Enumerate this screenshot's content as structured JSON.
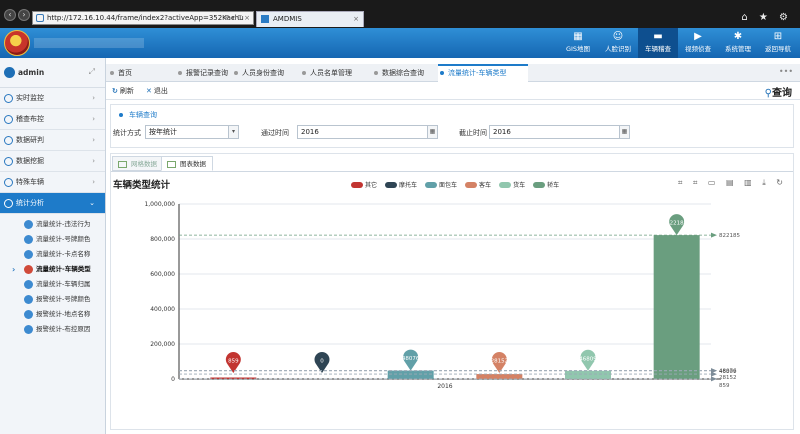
{
  "browser": {
    "url": "http://172.16.10.44/frame/index2?activeApp=352Kachu",
    "url_tools": "P ▾ C ×",
    "tab_title": "AMDMIS",
    "window_icons": "⌂ ★ ⚙"
  },
  "top_nav": [
    {
      "label": "GIS地图",
      "icon": "map-icon",
      "glyph": "▦",
      "active": false
    },
    {
      "label": "人脸识别",
      "icon": "face-scan-icon",
      "glyph": "☺",
      "active": false
    },
    {
      "label": "车辆稽查",
      "icon": "truck-icon",
      "glyph": "▬",
      "active": true
    },
    {
      "label": "视频侦查",
      "icon": "video-icon",
      "glyph": "▶",
      "active": false
    },
    {
      "label": "系统管理",
      "icon": "gear-icon",
      "glyph": "✱",
      "active": false
    },
    {
      "label": "返回导航",
      "icon": "grid-icon",
      "glyph": "⊞",
      "active": false
    }
  ],
  "sidebar": {
    "user": "admin",
    "menu": [
      {
        "label": "实时监控",
        "active": false
      },
      {
        "label": "稽查布控",
        "active": false
      },
      {
        "label": "数据研判",
        "active": false
      },
      {
        "label": "数据挖掘",
        "active": false
      },
      {
        "label": "特殊车辆",
        "active": false
      },
      {
        "label": "统计分析",
        "active": true
      }
    ],
    "sub_items": [
      {
        "label": "流量统计-违法行为",
        "current": false
      },
      {
        "label": "流量统计-号牌颜色",
        "current": false
      },
      {
        "label": "流量统计-卡点名称",
        "current": false
      },
      {
        "label": "流量统计-车辆类型",
        "current": true
      },
      {
        "label": "流量统计-车辆归属",
        "current": false
      },
      {
        "label": "报警统计-号牌颜色",
        "current": false
      },
      {
        "label": "报警统计-地点名称",
        "current": false
      },
      {
        "label": "报警统计-布控原因",
        "current": false
      }
    ]
  },
  "page_tabs": [
    {
      "label": "首页",
      "active": false
    },
    {
      "label": "报警记录查询",
      "active": false
    },
    {
      "label": "人员身份查询",
      "active": false
    },
    {
      "label": "人员名单管理",
      "active": false
    },
    {
      "label": "数据综合查询",
      "active": false
    },
    {
      "label": "流量统计-车辆类型",
      "active": true
    }
  ],
  "toolbar": {
    "refresh": "刷新",
    "exit": "退出",
    "query": "查询"
  },
  "filter": {
    "section_title": "车辆查询",
    "method_label": "统计方式",
    "method_value": "按年统计",
    "start_label": "通过时间",
    "start_value": "2016",
    "end_label": "截止时间",
    "end_value": "2016"
  },
  "chart_tabs": {
    "grid": "网格数据",
    "chart": "图表数据"
  },
  "chart_data": {
    "type": "bar",
    "title": "车辆类型统计",
    "categories": [
      "2016"
    ],
    "series": [
      {
        "name": "其它",
        "values": [
          859
        ],
        "color": "#c23531"
      },
      {
        "name": "摩托车",
        "values": [
          0
        ],
        "color": "#2f4554"
      },
      {
        "name": "面包车",
        "values": [
          48076
        ],
        "color": "#61a0a8"
      },
      {
        "name": "客车",
        "values": [
          28152
        ],
        "color": "#d48265"
      },
      {
        "name": "货车",
        "values": [
          46809
        ],
        "color": "#91c7ae"
      },
      {
        "name": "轿车",
        "values": [
          822185
        ],
        "color": "#6a9e7f"
      }
    ],
    "pin_labels": [
      "859",
      "0",
      "48076",
      "28152",
      "46809",
      "822185"
    ],
    "ylim": [
      0,
      1000000
    ],
    "yticks": [
      0,
      200000,
      400000,
      600000,
      800000,
      1000000
    ],
    "ytick_labels": [
      "0",
      "200,000",
      "400,000",
      "600,000",
      "800,000",
      "1,000,000"
    ],
    "markline_labels": [
      "822185",
      "48076",
      "46809",
      "28152",
      "859"
    ],
    "grid": true,
    "legend": "top-center"
  },
  "chart_tool_icons": "⌗ ⌗ ▭ ▤ ▥ ⤓ ↻"
}
